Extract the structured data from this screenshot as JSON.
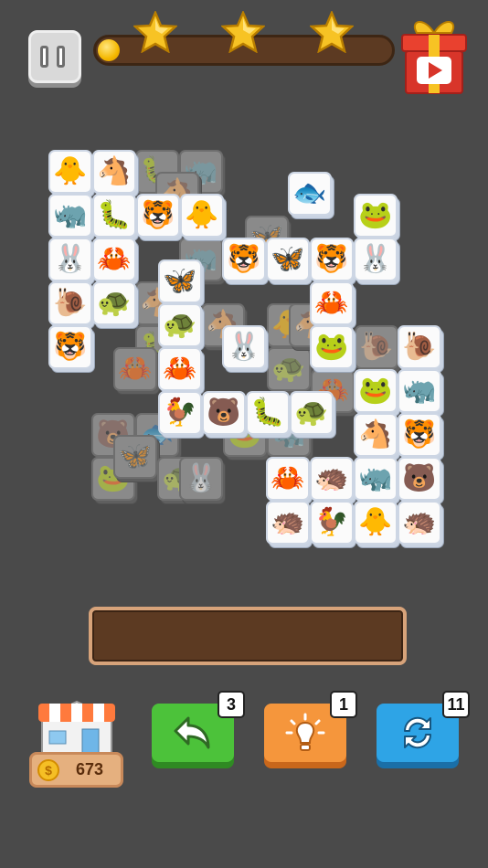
{
  "header": {
    "pause_icon": "pause-icon",
    "progress_fraction": 0.05,
    "stars": [
      "star-icon",
      "star-icon",
      "star-icon"
    ],
    "gift_icon": "gift-video-icon"
  },
  "board": {
    "active_tiles": [
      {
        "animal": "duck",
        "glyph": "🐥"
      },
      {
        "animal": "horse",
        "glyph": "🐴"
      },
      {
        "animal": "rhino",
        "glyph": "🦏"
      },
      {
        "animal": "caterpillar",
        "glyph": "🐛"
      },
      {
        "animal": "tiger",
        "glyph": "🐯"
      },
      {
        "animal": "duck",
        "glyph": "🐥"
      },
      {
        "animal": "rabbit",
        "glyph": "🐰"
      },
      {
        "animal": "crab",
        "glyph": "🦀"
      },
      {
        "animal": "snail",
        "glyph": "🐌"
      },
      {
        "animal": "turtle",
        "glyph": "🐢"
      },
      {
        "animal": "tiger",
        "glyph": "🐯"
      },
      {
        "animal": "fish",
        "glyph": "🐟"
      },
      {
        "animal": "frog",
        "glyph": "🐸"
      },
      {
        "animal": "tiger",
        "glyph": "🐯"
      },
      {
        "animal": "butterfly",
        "glyph": "🦋"
      },
      {
        "animal": "tiger",
        "glyph": "🐯"
      },
      {
        "animal": "rabbit",
        "glyph": "🐰"
      },
      {
        "animal": "butterfly",
        "glyph": "🦋"
      },
      {
        "animal": "turtle",
        "glyph": "🐢"
      },
      {
        "animal": "crab",
        "glyph": "🦀"
      },
      {
        "animal": "crab",
        "glyph": "🦀"
      },
      {
        "animal": "rabbit",
        "glyph": "🐰"
      },
      {
        "animal": "frog",
        "glyph": "🐸"
      },
      {
        "animal": "snail",
        "glyph": "🐌"
      },
      {
        "animal": "frog",
        "glyph": "🐸"
      },
      {
        "animal": "rhino",
        "glyph": "🦏"
      },
      {
        "animal": "rooster",
        "glyph": "🐓"
      },
      {
        "animal": "bear",
        "glyph": "🐻"
      },
      {
        "animal": "caterpillar",
        "glyph": "🐛"
      },
      {
        "animal": "turtle",
        "glyph": "🐢"
      },
      {
        "animal": "horse",
        "glyph": "🐴"
      },
      {
        "animal": "tiger",
        "glyph": "🐯"
      },
      {
        "animal": "crab",
        "glyph": "🦀"
      },
      {
        "animal": "hedgehog",
        "glyph": "🦔"
      },
      {
        "animal": "rhino",
        "glyph": "🦏"
      },
      {
        "animal": "bear",
        "glyph": "🐻"
      },
      {
        "animal": "hedgehog",
        "glyph": "🦔"
      },
      {
        "animal": "rooster",
        "glyph": "🐓"
      },
      {
        "animal": "duck",
        "glyph": "🐥"
      },
      {
        "animal": "hedgehog",
        "glyph": "🦔"
      }
    ],
    "covered_tiles": [
      {
        "animal": "caterpillar",
        "glyph": "🐛"
      },
      {
        "animal": "rhino",
        "glyph": "🦏"
      },
      {
        "animal": "horse",
        "glyph": "🐴"
      },
      {
        "animal": "rhino",
        "glyph": "🦏"
      },
      {
        "animal": "butterfly",
        "glyph": "🦋"
      },
      {
        "animal": "duck",
        "glyph": "🐥"
      },
      {
        "animal": "horse",
        "glyph": "🐴"
      },
      {
        "animal": "caterpillar",
        "glyph": "🐛"
      },
      {
        "animal": "horse",
        "glyph": "🐴"
      },
      {
        "animal": "turtle",
        "glyph": "🐢"
      },
      {
        "animal": "crab",
        "glyph": "🦀"
      },
      {
        "animal": "snail",
        "glyph": "🐌"
      },
      {
        "animal": "bear",
        "glyph": "🐻"
      },
      {
        "animal": "fish",
        "glyph": "🐟"
      },
      {
        "animal": "frog",
        "glyph": "🐸"
      },
      {
        "animal": "butterfly",
        "glyph": "🦋"
      },
      {
        "animal": "turtle",
        "glyph": "🐢"
      },
      {
        "animal": "rabbit",
        "glyph": "🐰"
      },
      {
        "animal": "frog",
        "glyph": "🐸"
      },
      {
        "animal": "rhino",
        "glyph": "🦏"
      },
      {
        "animal": "horse",
        "glyph": "🐴"
      },
      {
        "animal": "crab",
        "glyph": "🦀"
      }
    ]
  },
  "tray": {
    "slots_filled": 0
  },
  "shop": {
    "icon": "shop-icon",
    "coins": "673",
    "coin_icon": "coin-icon",
    "coin_symbol": "$"
  },
  "powerups": {
    "undo": {
      "icon": "undo-icon",
      "count": "3",
      "color": "#4cc23a"
    },
    "hint": {
      "icon": "lightbulb-icon",
      "count": "1",
      "color": "#f5963c"
    },
    "shuffle": {
      "icon": "shuffle-icon",
      "count": "11",
      "color": "#2ea4e6"
    }
  }
}
